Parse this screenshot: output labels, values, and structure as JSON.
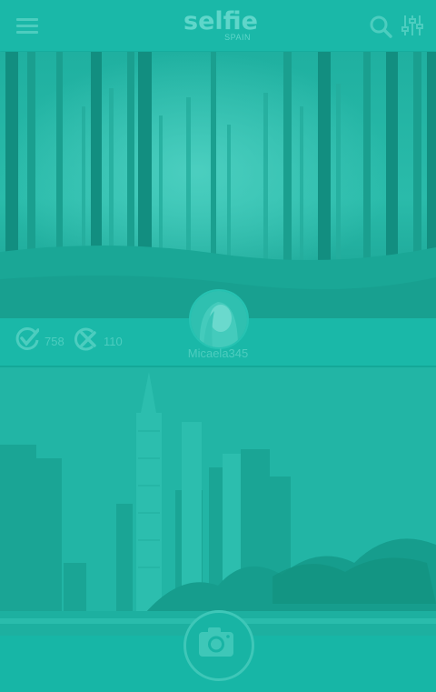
{
  "app": {
    "logo_main": "selfie",
    "logo_sub": "SPAIN"
  },
  "icons": {
    "menu": "menu-icon",
    "search": "search-icon",
    "filter": "filter-sliders-icon",
    "like": "check-circle-icon",
    "dislike": "x-circle-icon",
    "list": "list-icon",
    "share": "share-icon",
    "camera": "camera-icon"
  },
  "post": {
    "likes": "758",
    "dislikes": "110",
    "username": "Micaela345"
  },
  "colors": {
    "overlay": "#1ab8a8",
    "icon": "#4ccdbf"
  }
}
